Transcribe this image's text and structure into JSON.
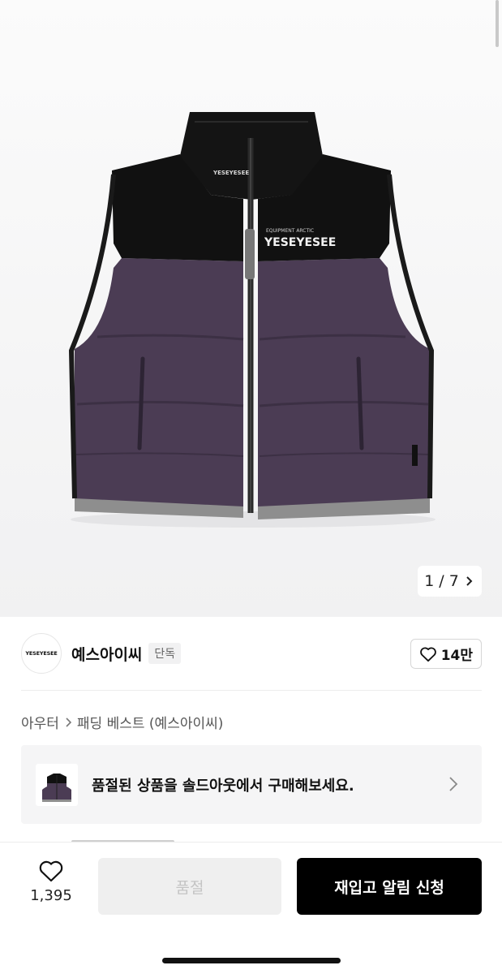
{
  "gallery": {
    "current": "1",
    "separator": "/",
    "total": "7",
    "vest_logo_small": "YESEYESEE",
    "vest_patch_top": "EQUIPMENT ARCTIC",
    "vest_patch_main": "YESEYESEE",
    "colors": {
      "body": "#4b3c54",
      "collar": "#111111",
      "hem": "#8e8e8e"
    }
  },
  "brand": {
    "logo_text": "YESEYESEE",
    "name": "예스아이씨",
    "badge": "단독",
    "likes": "14만"
  },
  "breadcrumb": {
    "category": "아우터",
    "subcategory": "패딩 베스트 (예스아이씨)"
  },
  "banner": {
    "text": "품절된 상품을 솔드아웃에서 구매해보세요."
  },
  "bottom_bar": {
    "wish_count": "1,395",
    "soldout_label": "품절",
    "restock_label": "재입고 알림 신청"
  }
}
